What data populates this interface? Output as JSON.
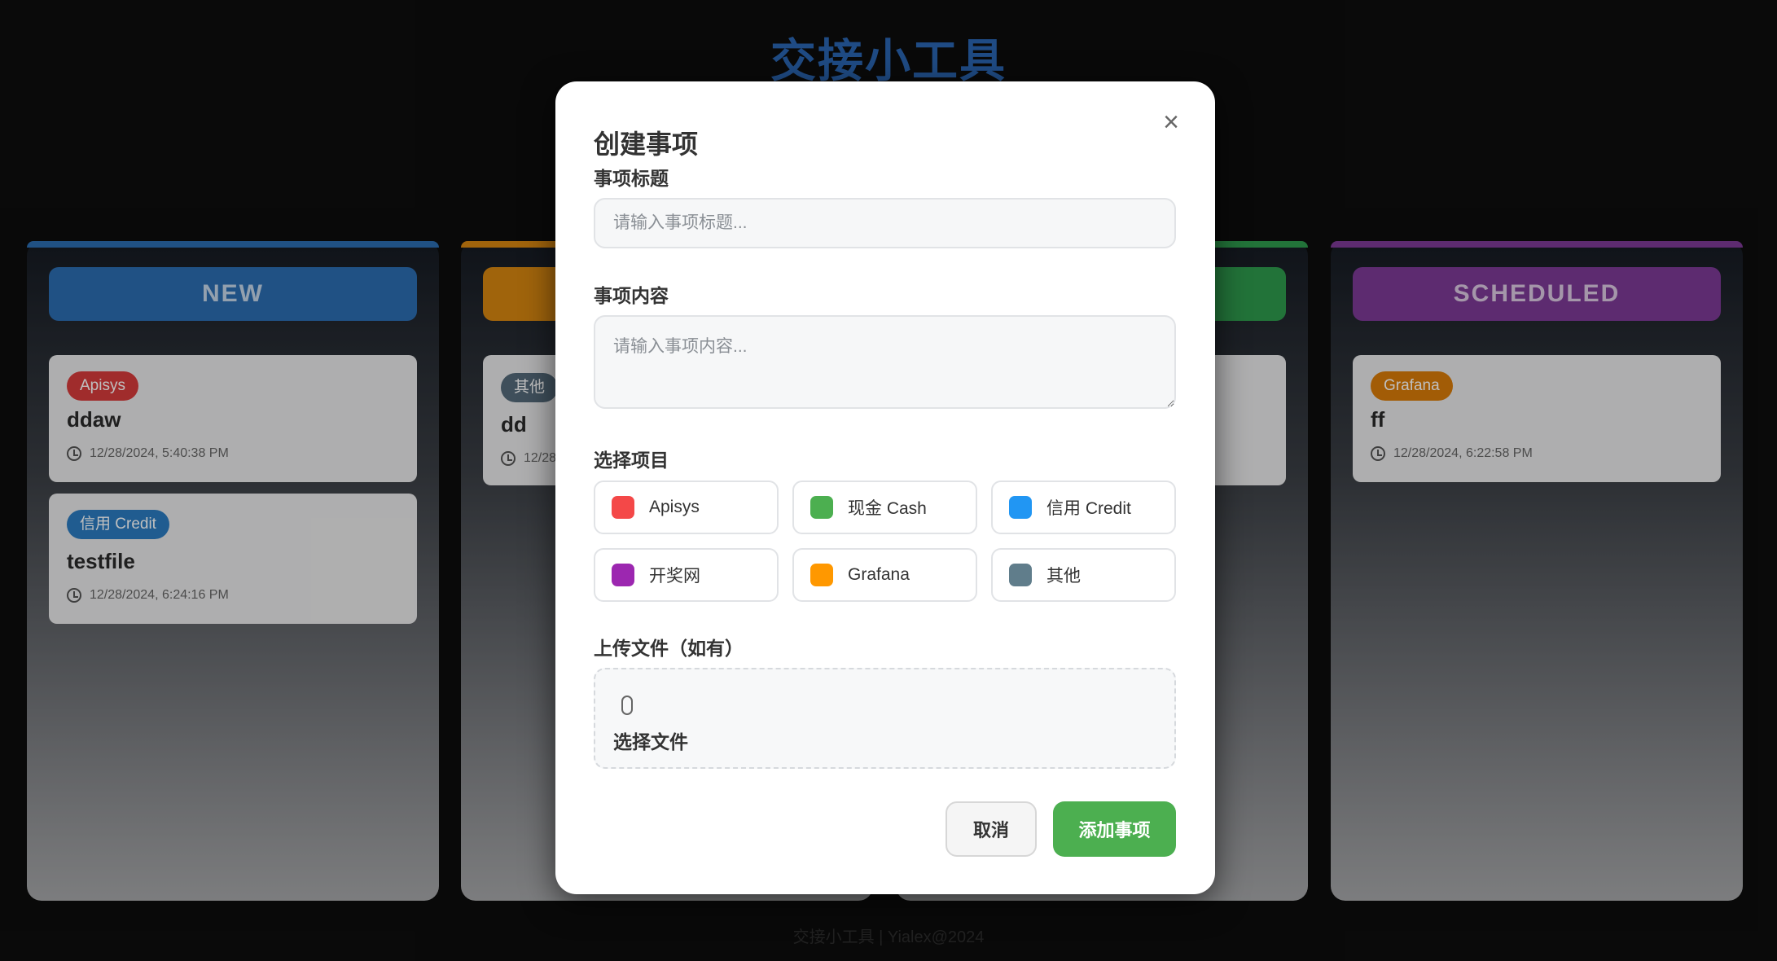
{
  "app_title": "交接小工具",
  "footer": "交接小工具 | Yialex@2024",
  "columns": [
    {
      "title": "NEW",
      "accent": "#2b6cb0",
      "cards": [
        {
          "tag": "Apisys",
          "tag_color": "#d63b3b",
          "title": "ddaw",
          "time": "12/28/2024, 5:40:38 PM"
        },
        {
          "tag": "信用 Credit",
          "tag_color": "#2b7bc0",
          "title": "testfile",
          "time": "12/28/2024, 6:24:16 PM"
        }
      ]
    },
    {
      "title": "",
      "accent": "#d68610",
      "cards": [
        {
          "tag": "其他",
          "tag_color": "#546a7a",
          "title": "dd",
          "time": "12/28"
        }
      ]
    },
    {
      "title": "",
      "accent": "#2e9a4c",
      "cards": []
    },
    {
      "title": "SCHEDULED",
      "accent": "#7d3a96",
      "cards": [
        {
          "tag": "Grafana",
          "tag_color": "#d97b09",
          "title": "ff",
          "time": "12/28/2024, 6:22:58 PM"
        }
      ]
    }
  ],
  "modal": {
    "title": "创建事项",
    "close_icon": "×",
    "title_label": "事项标题",
    "title_placeholder": "请输入事项标题...",
    "content_label": "事项内容",
    "content_placeholder": "请输入事项内容...",
    "project_label": "选择项目",
    "projects": [
      {
        "name": "Apisys",
        "color": "#f44848"
      },
      {
        "name": "现金 Cash",
        "color": "#4caf50"
      },
      {
        "name": "信用 Credit",
        "color": "#2196f3"
      },
      {
        "name": "开奖网",
        "color": "#9c27b0"
      },
      {
        "name": "Grafana",
        "color": "#ff9800"
      },
      {
        "name": "其他",
        "color": "#607d8b"
      }
    ],
    "upload_label": "上传文件（如有）",
    "upload_text": "选择文件",
    "cancel": "取消",
    "submit": "添加事项"
  }
}
